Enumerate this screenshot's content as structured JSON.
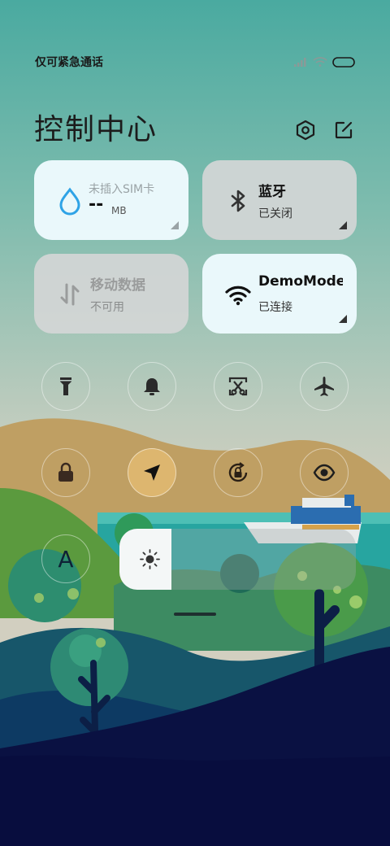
{
  "status_bar": {
    "carrier_text": "仅可紧急通话",
    "icons": [
      "signal-icon",
      "wifi-icon",
      "battery-icon"
    ]
  },
  "header": {
    "title": "控制中心",
    "settings_icon": "settings-icon",
    "edit_icon": "edit-icon"
  },
  "tiles": {
    "data_usage": {
      "line1": "未插入SIM卡",
      "value": "--",
      "unit": "MB",
      "icon": "water-drop-icon"
    },
    "bluetooth": {
      "line1": "蓝牙",
      "line2": "已关闭",
      "icon": "bluetooth-icon"
    },
    "mobile_data": {
      "line1": "移动数据",
      "line2": "不可用",
      "icon": "mobile-data-icon"
    },
    "wifi": {
      "line1": "DemoMode",
      "line2": "已连接",
      "icon": "wifi-icon"
    }
  },
  "toggles": [
    {
      "name": "flashlight",
      "icon": "flashlight-icon",
      "active": false
    },
    {
      "name": "bell",
      "icon": "bell-icon",
      "active": false
    },
    {
      "name": "screenshot",
      "icon": "screenshot-icon",
      "active": false
    },
    {
      "name": "airplane",
      "icon": "airplane-icon",
      "active": false
    },
    {
      "name": "lock",
      "icon": "lock-icon",
      "active": false
    },
    {
      "name": "location",
      "icon": "location-arrow-icon",
      "active": true
    },
    {
      "name": "rotation-lock",
      "icon": "rotation-lock-icon",
      "active": false
    },
    {
      "name": "reading-mode",
      "icon": "eye-icon",
      "active": false
    },
    {
      "name": "auto-brightness",
      "icon": "letter-a-icon",
      "label": "A",
      "active": false
    }
  ],
  "brightness": {
    "level": 0.22,
    "icon": "sun-icon"
  },
  "colors": {
    "tile_light": "#eaf8fb",
    "tile_gray": "#d4d6d6",
    "active_toggle": "#ddb66f",
    "wifi_blue": "#2fa3e6",
    "sky_top": "#4aaaa0",
    "ground_navy": "#0a1142"
  }
}
